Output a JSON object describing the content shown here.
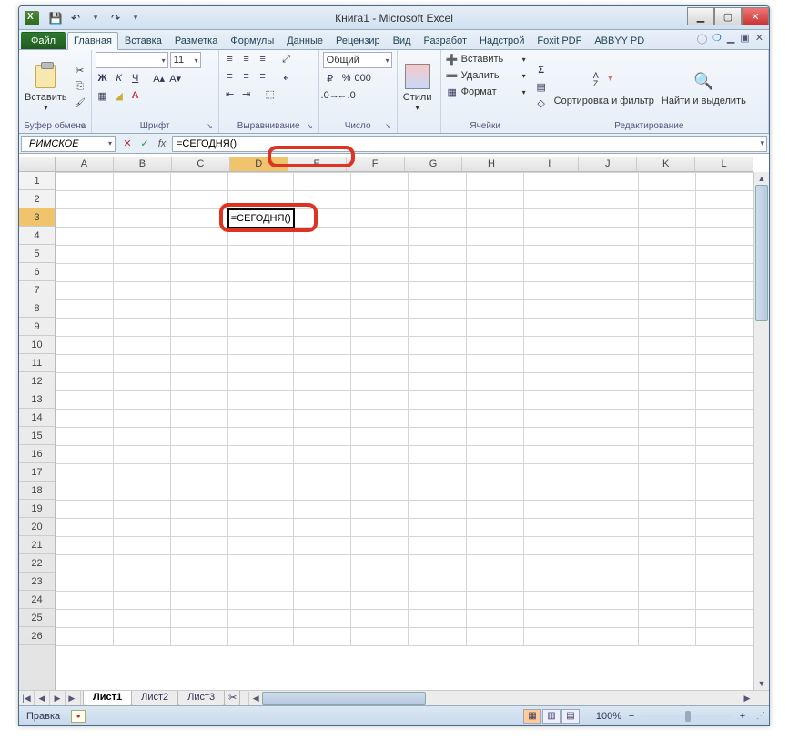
{
  "window": {
    "title": "Книга1 - Microsoft Excel"
  },
  "tabs": {
    "file": "Файл",
    "items": [
      "Главная",
      "Вставка",
      "Разметка",
      "Формулы",
      "Данные",
      "Рецензир",
      "Вид",
      "Разработ",
      "Надстрой",
      "Foxit PDF",
      "ABBYY PD"
    ],
    "active": 0
  },
  "ribbon": {
    "clipboard": {
      "paste": "Вставить",
      "label": "Буфер обмена"
    },
    "font": {
      "name": "",
      "size": "11",
      "label": "Шрифт"
    },
    "align": {
      "label": "Выравнивание"
    },
    "number": {
      "format": "Общий",
      "label": "Число"
    },
    "styles": {
      "btn": "Стили"
    },
    "cells": {
      "insert": "Вставить",
      "delete": "Удалить",
      "format": "Формат",
      "label": "Ячейки"
    },
    "editing": {
      "sort": "Сортировка и фильтр",
      "find": "Найти и выделить",
      "label": "Редактирование"
    }
  },
  "namebox": "РИМСКОЕ",
  "formula": "=СЕГОДНЯ()",
  "cell_value": "=СЕГОДНЯ()",
  "columns": [
    "A",
    "B",
    "C",
    "D",
    "E",
    "F",
    "G",
    "H",
    "I",
    "J",
    "K",
    "L"
  ],
  "rows": 26,
  "active_cell": {
    "col": 3,
    "row": 2
  },
  "sheets": {
    "items": [
      "Лист1",
      "Лист2",
      "Лист3"
    ],
    "active": 0
  },
  "status": {
    "mode": "Правка",
    "zoom": "100%"
  }
}
